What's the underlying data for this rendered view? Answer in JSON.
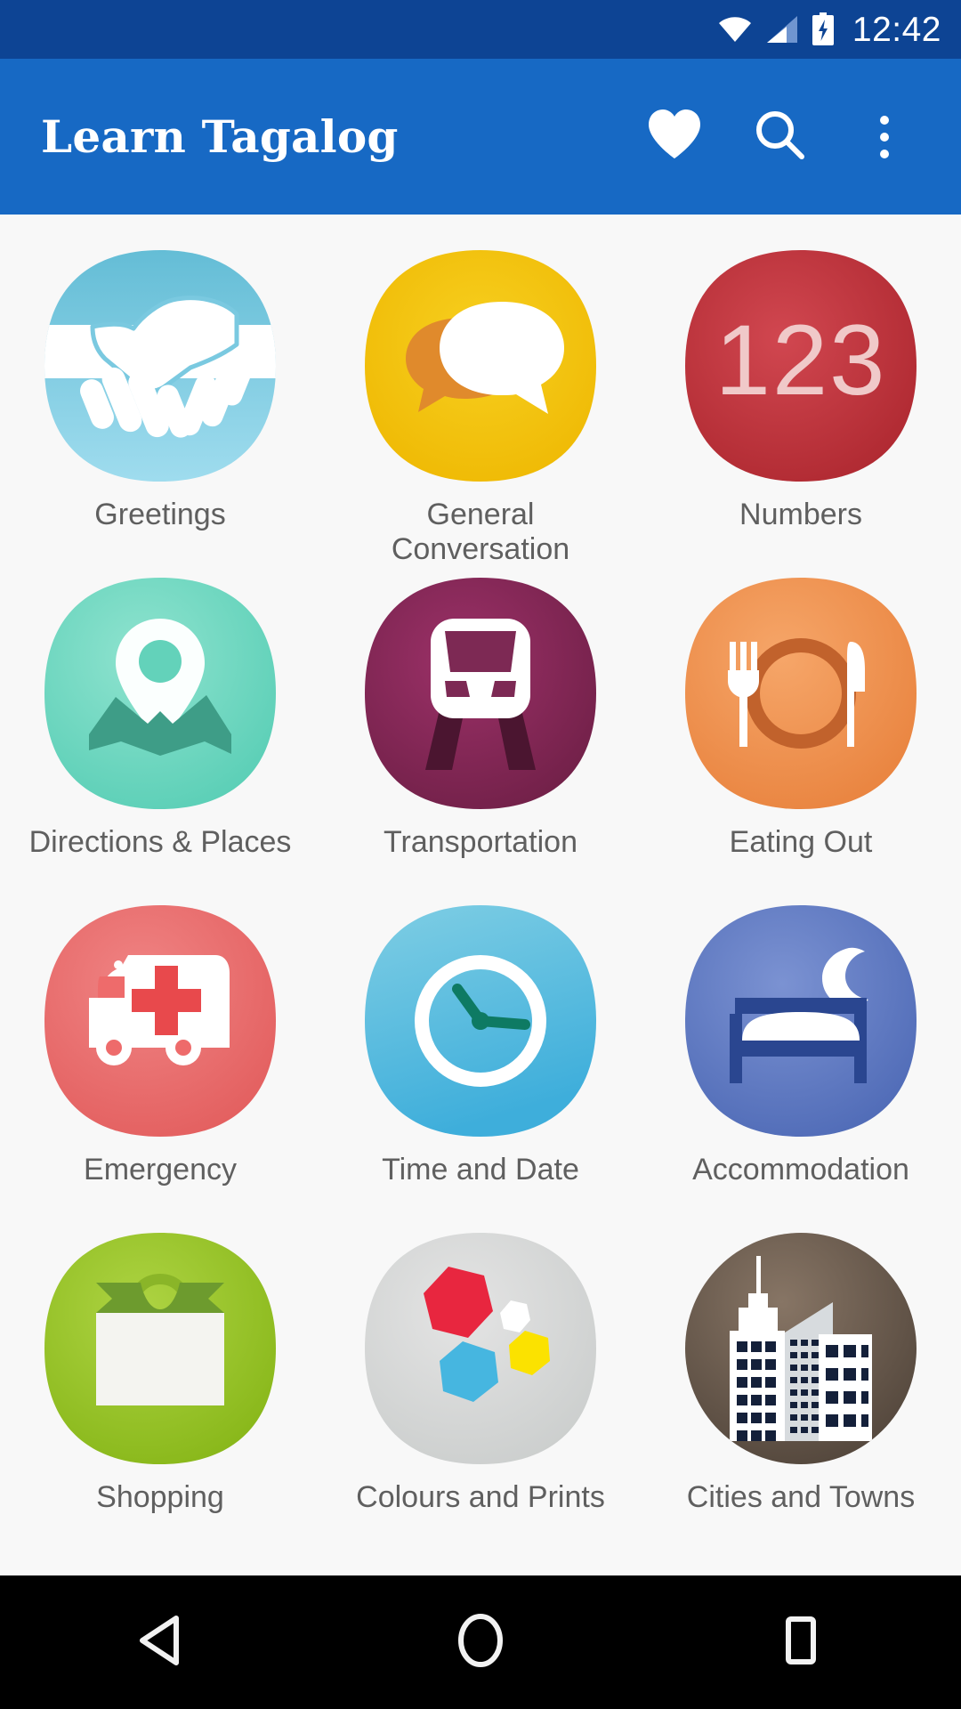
{
  "status_bar": {
    "time": "12:42",
    "icons": [
      "wifi-icon",
      "cellular-signal-icon",
      "battery-charging-icon"
    ],
    "background": "#0d4494"
  },
  "app_bar": {
    "title": "Learn Tagalog",
    "background": "#1769c4",
    "actions": [
      {
        "name": "favorites-button",
        "icon": "heart-icon"
      },
      {
        "name": "search-button",
        "icon": "search-icon"
      },
      {
        "name": "overflow-menu-button",
        "icon": "more-vertical-icon"
      }
    ]
  },
  "grid": {
    "columns": 3,
    "items": [
      {
        "label": "Greetings",
        "icon": "handshake-icon",
        "color": "#6ec6dd"
      },
      {
        "label": "General\nConversation",
        "label_line1": "General",
        "label_line2": "Conversation",
        "icon": "speech-bubbles-icon",
        "color": "#f2c312"
      },
      {
        "label": "Numbers",
        "icon": "numbers-123-icon",
        "color": "#c12f39"
      },
      {
        "label": "Directions & Places",
        "icon": "map-pin-icon",
        "color": "#66d6c0"
      },
      {
        "label": "Transportation",
        "icon": "train-icon",
        "color": "#8c2b5e"
      },
      {
        "label": "Eating Out",
        "icon": "cutlery-plate-icon",
        "color": "#ef8f4d"
      },
      {
        "label": "Emergency",
        "icon": "ambulance-icon",
        "color": "#ee6b6b"
      },
      {
        "label": "Time and Date",
        "icon": "clock-icon",
        "color": "#56bde0"
      },
      {
        "label": "Accommodation",
        "icon": "bed-moon-icon",
        "color": "#5d79c4"
      },
      {
        "label": "Shopping",
        "icon": "shopping-bag-icon",
        "color": "#97c221"
      },
      {
        "label": "Colours and Prints",
        "icon": "hexagons-icon",
        "color": "#d8d8d8"
      },
      {
        "label": "Cities and Towns",
        "icon": "city-skyline-icon",
        "color": "#6e5d4e"
      }
    ]
  },
  "nav_bar": {
    "background": "#000000",
    "buttons": [
      {
        "name": "nav-back-button",
        "icon": "triangle-back-icon"
      },
      {
        "name": "nav-home-button",
        "icon": "circle-home-icon"
      },
      {
        "name": "nav-recents-button",
        "icon": "square-recents-icon"
      }
    ]
  },
  "label_color": "#5f5f5f",
  "page_background": "#f8f8f8"
}
